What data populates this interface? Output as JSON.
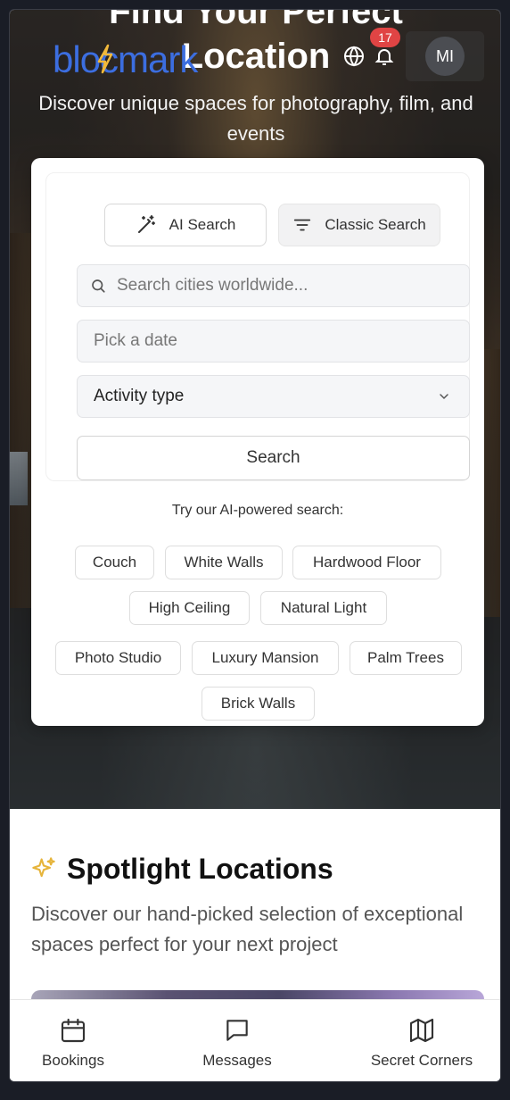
{
  "hero": {
    "title_line1": "Find Your Perfect",
    "title_line2": "Location",
    "subtitle": "Discover unique spaces for photography, film, and events"
  },
  "header": {
    "logo_text": "blocmark",
    "notification_count": "17",
    "avatar_initials": "MI"
  },
  "search": {
    "mode_ai_label": "AI Search",
    "mode_classic_label": "Classic Search",
    "location_placeholder": "Search cities worldwide...",
    "date_placeholder": "Pick a date",
    "activity_value": "Activity type",
    "submit_label": "Search"
  },
  "suggestions": {
    "label": "Try our AI-powered search:",
    "chips": [
      "Couch",
      "White Walls",
      "Hardwood Floor",
      "High Ceiling",
      "Natural Light",
      "Photo Studio",
      "Luxury Mansion",
      "Palm Trees",
      "Brick Walls"
    ]
  },
  "spotlight": {
    "title": "Spotlight Locations",
    "subtitle": "Discover our hand-picked selection of exceptional spaces perfect for your next project"
  },
  "bottom_nav": {
    "items": [
      {
        "label": "Bookings",
        "icon": "calendar-icon"
      },
      {
        "label": "Messages",
        "icon": "message-icon"
      },
      {
        "label": "Secret Corners",
        "icon": "map-icon"
      }
    ]
  },
  "colors": {
    "logo_blue": "#3c6ee0",
    "logo_accent": "#f2b93b",
    "badge_red": "#e04444",
    "sparkle_yellow": "#e6b43a"
  }
}
